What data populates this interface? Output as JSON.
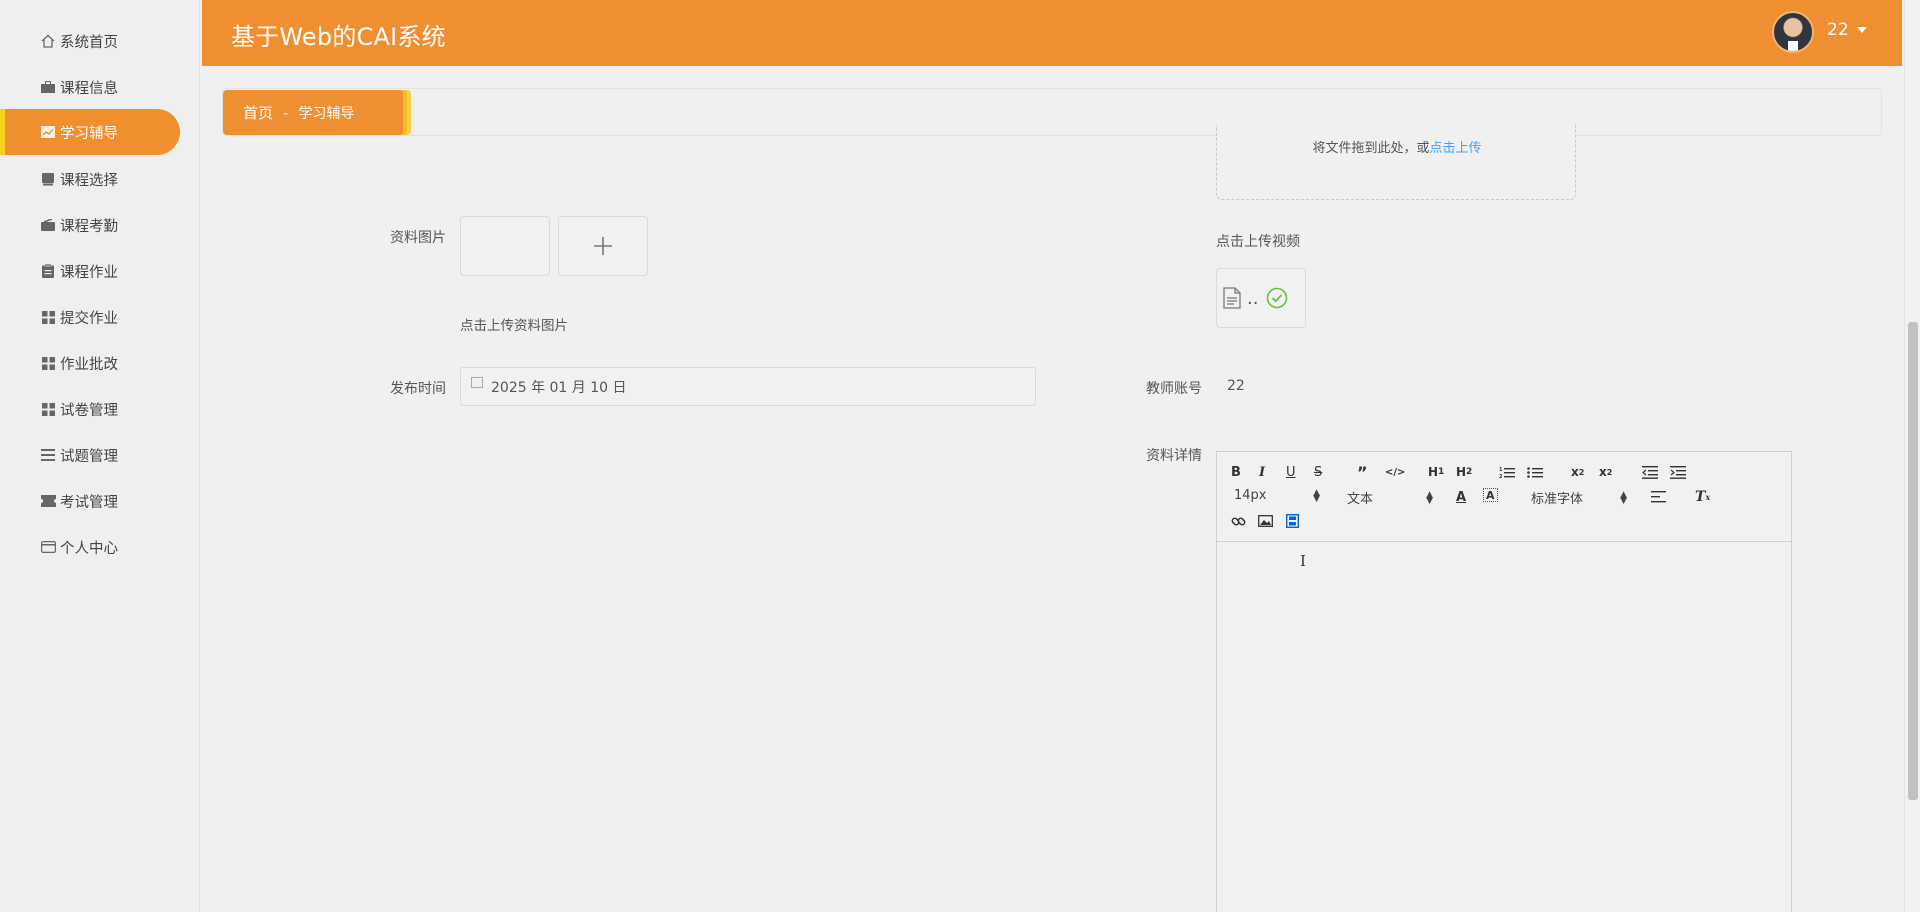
{
  "app": {
    "title": "基于Web的CAI系统",
    "user_name": "22"
  },
  "sidebar": {
    "items": [
      {
        "label": "系统首页",
        "icon": "home-icon"
      },
      {
        "label": "课程信息",
        "icon": "briefcase-icon"
      },
      {
        "label": "学习辅导",
        "icon": "chart-icon",
        "active": true
      },
      {
        "label": "课程选择",
        "icon": "book-icon"
      },
      {
        "label": "课程考勤",
        "icon": "wallet-icon"
      },
      {
        "label": "课程作业",
        "icon": "clipboard-icon"
      },
      {
        "label": "提交作业",
        "icon": "grid-icon"
      },
      {
        "label": "作业批改",
        "icon": "grid-icon"
      },
      {
        "label": "试卷管理",
        "icon": "grid-icon"
      },
      {
        "label": "试题管理",
        "icon": "list-icon"
      },
      {
        "label": "考试管理",
        "icon": "ticket-icon"
      },
      {
        "label": "个人中心",
        "icon": "card-icon"
      }
    ]
  },
  "breadcrumb": {
    "home": "首页",
    "separator": "-",
    "current": "学习辅导"
  },
  "form": {
    "dropzone_text": "将文件拖到此处，或",
    "dropzone_link": "点击上传",
    "image_label": "资料图片",
    "image_hint": "点击上传资料图片",
    "video_hint": "点击上传视频",
    "video_file_name": "..",
    "publish_time_label": "发布时间",
    "publish_time_value": "2025 年 01 月 10 日",
    "teacher_account_label": "教师账号",
    "teacher_account_value": "22",
    "detail_label": "资料详情"
  },
  "editor": {
    "font_size": "14px",
    "block_type": "文本",
    "font_family": "标准字体"
  },
  "colors": {
    "accent": "#ef8f31",
    "active_bar": "#f5d21f",
    "link": "#409eff",
    "success": "#67c23a"
  }
}
